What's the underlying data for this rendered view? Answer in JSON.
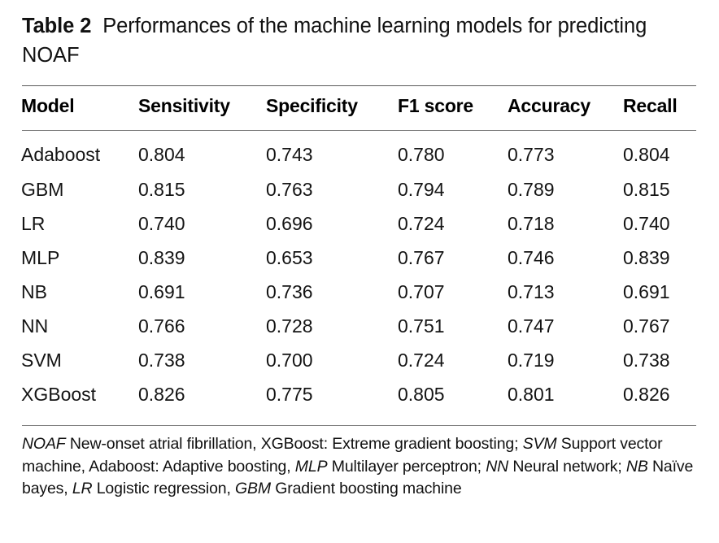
{
  "caption": {
    "label": "Table 2",
    "text": "Performances of the machine learning models for predicting NOAF"
  },
  "table": {
    "columns": [
      "Model",
      "Sensitivity",
      "Specificity",
      "F1 score",
      "Accuracy",
      "Recall"
    ],
    "rows": [
      {
        "model": "Adaboost",
        "sensitivity": "0.804",
        "specificity": "0.743",
        "f1": "0.780",
        "accuracy": "0.773",
        "recall": "0.804"
      },
      {
        "model": "GBM",
        "sensitivity": "0.815",
        "specificity": "0.763",
        "f1": "0.794",
        "accuracy": "0.789",
        "recall": "0.815"
      },
      {
        "model": "LR",
        "sensitivity": "0.740",
        "specificity": "0.696",
        "f1": "0.724",
        "accuracy": "0.718",
        "recall": "0.740"
      },
      {
        "model": "MLP",
        "sensitivity": "0.839",
        "specificity": "0.653",
        "f1": "0.767",
        "accuracy": "0.746",
        "recall": "0.839"
      },
      {
        "model": "NB",
        "sensitivity": "0.691",
        "specificity": "0.736",
        "f1": "0.707",
        "accuracy": "0.713",
        "recall": "0.691"
      },
      {
        "model": "NN",
        "sensitivity": "0.766",
        "specificity": "0.728",
        "f1": "0.751",
        "accuracy": "0.747",
        "recall": "0.767"
      },
      {
        "model": "SVM",
        "sensitivity": "0.738",
        "specificity": "0.700",
        "f1": "0.724",
        "accuracy": "0.719",
        "recall": "0.738"
      },
      {
        "model": "XGBoost",
        "sensitivity": "0.826",
        "specificity": "0.775",
        "f1": "0.805",
        "accuracy": "0.801",
        "recall": "0.826"
      }
    ]
  },
  "footnote": {
    "segments": [
      {
        "text": "NOAF",
        "italic": true
      },
      {
        "text": " New-onset atrial fibrillation, XGBoost: Extreme gradient boosting; ",
        "italic": false
      },
      {
        "text": "SVM",
        "italic": true
      },
      {
        "text": " Support vector machine, Adaboost: Adaptive boosting, ",
        "italic": false
      },
      {
        "text": "MLP",
        "italic": true
      },
      {
        "text": " Multilayer perceptron; ",
        "italic": false
      },
      {
        "text": "NN",
        "italic": true
      },
      {
        "text": " Neural network; ",
        "italic": false
      },
      {
        "text": "NB",
        "italic": true
      },
      {
        "text": " Naïve bayes, ",
        "italic": false
      },
      {
        "text": "LR",
        "italic": true
      },
      {
        "text": " Logistic regression, ",
        "italic": false
      },
      {
        "text": "GBM",
        "italic": true
      },
      {
        "text": " Gradient boosting machine",
        "italic": false
      }
    ]
  },
  "colors": {
    "background": "#ffffff",
    "text": "#111111",
    "rule": "#7d7d7d"
  }
}
